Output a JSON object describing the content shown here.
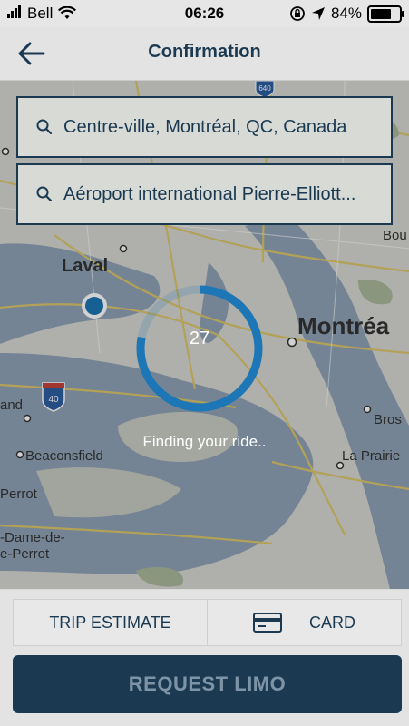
{
  "status": {
    "carrier": "Bell",
    "time": "06:26",
    "battery": "84%",
    "battery_level": 0.84
  },
  "header": {
    "title": "Confirmation"
  },
  "search": {
    "origin": "Centre-ville, Montréal, QC, Canada",
    "destination": "Aéroport international Pierre-Elliott..."
  },
  "map": {
    "labels": {
      "laval": "Laval",
      "montreal": "Montréa",
      "beaconsfield": "Beaconsfield",
      "perrot": "Perrot",
      "dame": "-Dame-de-",
      "perrot2": "e-Perrot",
      "and": "and",
      "brossard": "Bros",
      "laprairie": "La Prairie",
      "bou": "Bou",
      "hwy640": "640",
      "hwy40": "40"
    }
  },
  "ride_search": {
    "countdown": "27",
    "message": "Finding your ride..",
    "progress": 0.78
  },
  "tabs": {
    "trip_estimate": "TRIP ESTIMATE",
    "card": "CARD"
  },
  "actions": {
    "request_label": "REQUEST LIMO"
  },
  "colors": {
    "navy": "#1b3a52",
    "accent_blue": "#1d76b5"
  }
}
